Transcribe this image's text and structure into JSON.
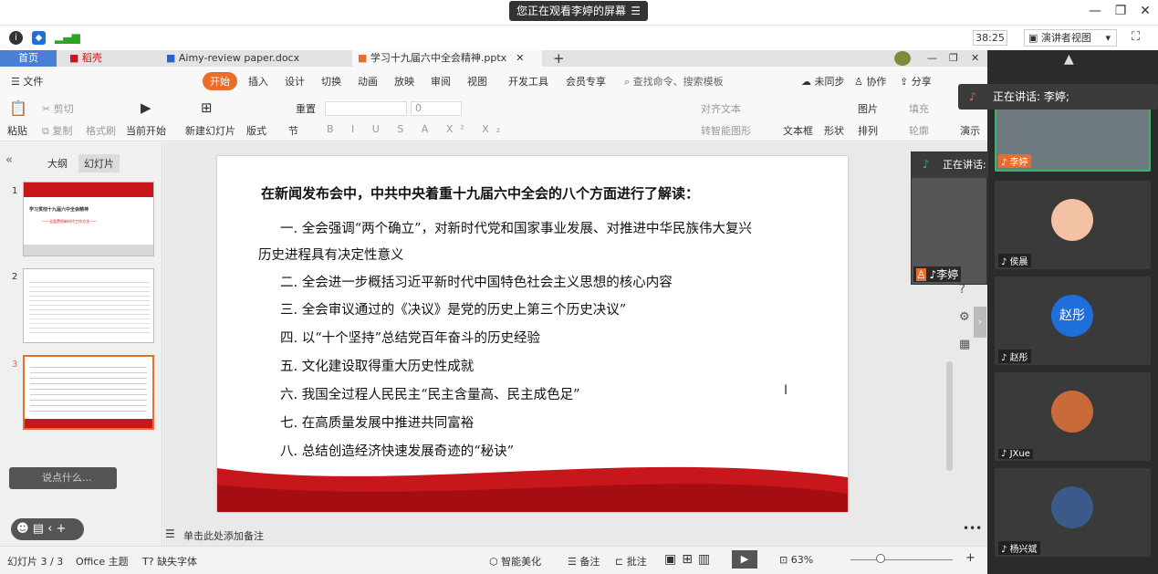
{
  "topbar": {
    "share_status": "您正在观看李婷的屏幕",
    "share_menu": "☰"
  },
  "sharebar": {
    "timer": "38:25",
    "presenter_view": "演讲者视图"
  },
  "tabs": [
    {
      "label": "首页"
    },
    {
      "label": "稻壳"
    },
    {
      "label": "Aimy-review paper.docx"
    },
    {
      "label": "学习十九届六中全会精神.pptx"
    }
  ],
  "menu": {
    "file": "文件",
    "items": [
      "开始",
      "插入",
      "设计",
      "切换",
      "动画",
      "放映",
      "审阅",
      "视图",
      "开发工具",
      "会员专享"
    ],
    "search": "查找命令、搜索模板",
    "sync": "未同步",
    "collab": "协作",
    "share": "分享"
  },
  "ribbon": {
    "paste": "粘贴",
    "cut": "剪切",
    "copy": "复制",
    "format_painter": "格式刷",
    "from_current": "当前开始",
    "new_slide": "新建幻灯片",
    "layout": "版式",
    "section": "节",
    "reset": "重置",
    "font_size": "0",
    "align_text": "对齐文本",
    "smart_art": "转智能图形",
    "textbox": "文本框",
    "shape": "形状",
    "picture": "图片",
    "fill": "填充",
    "arrange": "排列",
    "outline": "轮廓",
    "present": "演示"
  },
  "leftpanel": {
    "tab_outline": "大纲",
    "tab_slides": "幻灯片",
    "thumb1_title": "学习贯彻十九届六中全会精神",
    "thumb1_sub": "——全面贯彻新时代工作方法——",
    "say": "说点什么..."
  },
  "slide": {
    "heading": "在新闻发布会中，中共中央着重十九届六中全会的八个方面进行了解读：",
    "line1a": "一. 全会强调“两个确立”，对新时代党和国家事业发展、对推进中华民族伟大复兴",
    "line1b": "历史进程具有决定性意义",
    "line2": "二. 全会进一步概括习近平新时代中国特色社会主义思想的核心内容",
    "line3": "三. 全会审议通过的《决议》是党的历史上第三个历史决议”",
    "line4": "四. 以“十个坚持”总结党百年奋斗的历史经验",
    "line5": "五. 文化建设取得重大历史性成就",
    "line6": "六. 我国全过程人民民主“民主含量高、民主成色足”",
    "line7": "七. 在高质量发展中推进共同富裕",
    "line8": "八. 总结创造经济快速发展奇迹的“秘诀”"
  },
  "notes": {
    "placeholder": "单击此处添加备注"
  },
  "status": {
    "slide_count": "幻灯片 3 / 3",
    "theme": "Office 主题",
    "missing_font": "缺失字体",
    "beautify": "智能美化",
    "notes": "备注",
    "comments": "批注",
    "zoom": "63%"
  },
  "video": {
    "talking": "正在讲话: 李婷;",
    "talking_short": "正在讲话:",
    "participants": [
      {
        "name": "李婷"
      },
      {
        "name": "侯晨"
      },
      {
        "name": "赵彤",
        "avatar_text": "赵彤"
      },
      {
        "name": "JXue"
      },
      {
        "name": "杨兴斌"
      }
    ]
  },
  "colors": {
    "accent": "#e86c2c",
    "avatar_blue": "#1e6fd9",
    "wps_red": "#c8161d"
  }
}
